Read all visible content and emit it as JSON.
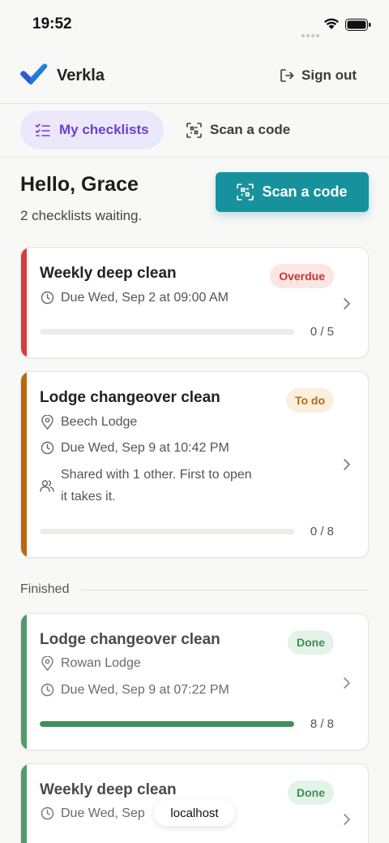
{
  "status_bar": {
    "time": "19:52"
  },
  "app_bar": {
    "brand": "Verkla",
    "sign_out_label": "Sign out"
  },
  "tabs": [
    {
      "label": "My checklists",
      "active": true
    },
    {
      "label": "Scan a code",
      "active": false
    }
  ],
  "header": {
    "greeting": "Hello, Grace",
    "subtitle": "2 checklists waiting.",
    "scan_button_label": "Scan a code"
  },
  "pending": [
    {
      "title": "Weekly deep clean",
      "badge": "Overdue",
      "due": "Due Wed, Sep 2 at 09:00 AM",
      "progress_label": "0 / 5",
      "progress": 0,
      "accent_color": "#d43f3a"
    },
    {
      "title": "Lodge changeover clean",
      "badge": "To do",
      "location": "Beech Lodge",
      "due": "Due Wed, Sep 9 at 10:42 PM",
      "shared": "Shared with 1 other. First to open it takes it.",
      "shared_line1": "Shared with 1 other. First to open",
      "shared_line2": "it takes it.",
      "progress_label": "0 / 8",
      "progress": 0,
      "accent_color": "#b8690e"
    }
  ],
  "finished_label": "Finished",
  "finished": [
    {
      "title": "Lodge changeover clean",
      "badge": "Done",
      "location": "Rowan Lodge",
      "due": "Due Wed, Sep 9 at 07:22 PM",
      "progress_label": "8 / 8",
      "progress": 1,
      "accent_color": "#4f9a6a"
    },
    {
      "title": "Weekly deep clean",
      "badge": "Done",
      "due": "Due Wed, Sep",
      "accent_color": "#4f9a6a"
    }
  ],
  "toast": "localhost",
  "colors": {
    "accent_teal": "#17929d",
    "tab_active": "#6b3fd4",
    "overdue": "#c8352f",
    "todo": "#b06a12",
    "done": "#3d8d57"
  }
}
